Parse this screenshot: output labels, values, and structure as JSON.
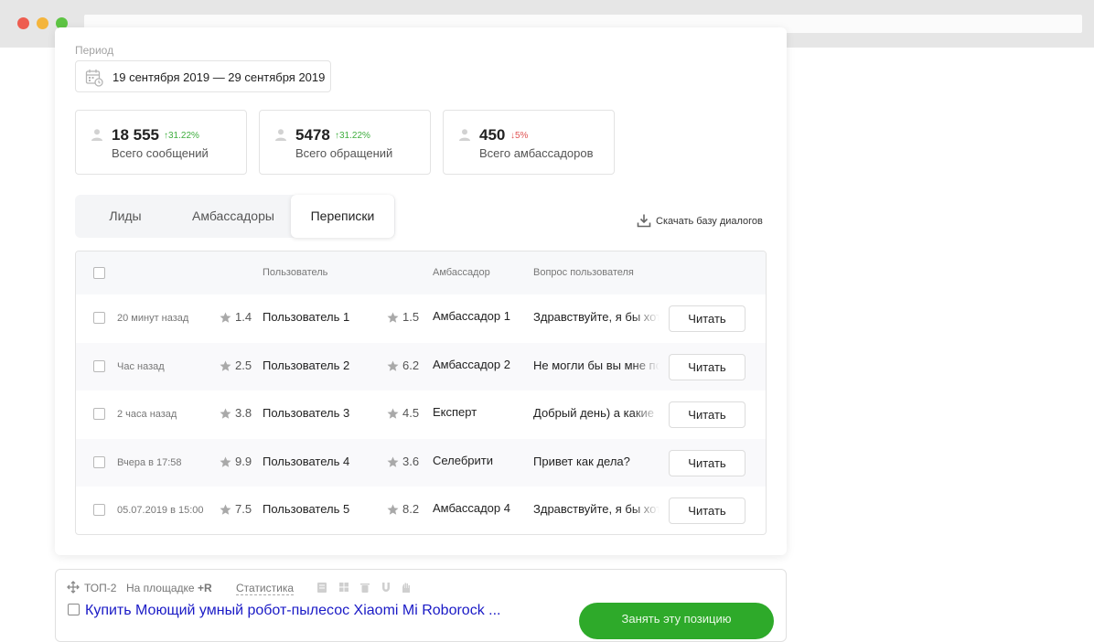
{
  "period": {
    "label": "Период",
    "range": "19 сентября 2019 — 29 сентября 2019"
  },
  "stats": [
    {
      "value": "18 555",
      "change": "↑31.22%",
      "direction": "up",
      "label": "Всего сообщений"
    },
    {
      "value": "5478",
      "change": "↑31.22%",
      "direction": "up",
      "label": "Всего обращений"
    },
    {
      "value": "450",
      "change": "↓5%",
      "direction": "down",
      "label": "Всего амбассадоров"
    }
  ],
  "tabs": [
    {
      "label": "Лиды",
      "active": false
    },
    {
      "label": "Амбассадоры",
      "active": false
    },
    {
      "label": "Переписки",
      "active": true
    }
  ],
  "download": {
    "label": "Скачать базу диалогов",
    "icon": "download-icon"
  },
  "table": {
    "headers": {
      "user": "Пользователь",
      "ambassador": "Амбассадор",
      "question": "Вопрос пользователя"
    },
    "rows": [
      {
        "time": "20 минут назад",
        "user_rating": "1.4",
        "user": "Пользователь 1",
        "amb_rating": "1.5",
        "ambassador": "Амбассадор 1",
        "question": "Здравствуйте, я бы хотел",
        "action": "Читать"
      },
      {
        "time": "Час назад",
        "user_rating": "2.5",
        "user": "Пользователь 2",
        "amb_rating": "6.2",
        "ambassador": "Амбассадор 2",
        "question": "Не могли бы вы мне помочь",
        "action": "Читать"
      },
      {
        "time": "2 часа назад",
        "user_rating": "3.8",
        "user": "Пользователь 3",
        "amb_rating": "4.5",
        "ambassador": "Експерт",
        "question": "Добрый день) а какие",
        "action": "Читать"
      },
      {
        "time": "Вчера в 17:58",
        "user_rating": "9.9",
        "user": "Пользователь 4",
        "amb_rating": "3.6",
        "ambassador": "Селебрити",
        "question": "Привет как дела?",
        "action": "Читать"
      },
      {
        "time": "05.07.2019 в 15:00",
        "user_rating": "7.5",
        "user": "Пользователь 5",
        "amb_rating": "8.2",
        "ambassador": "Амбассадор 4",
        "question": "Здравствуйте, я бы хотел",
        "action": "Читать"
      }
    ]
  },
  "bottom": {
    "rank": "ТОП-2",
    "platform": "На площадке",
    "platform_badge": "+R",
    "stats_link": "Статистика",
    "product": "Купить Моющий умный робот-пылесос Xiaomi Mi Roborock ...",
    "cta": "Занять эту позицию"
  },
  "colors": {
    "up": "#3fae3f",
    "down": "#e05454",
    "cta": "#2eaa2a",
    "link": "#1a1ac6"
  }
}
